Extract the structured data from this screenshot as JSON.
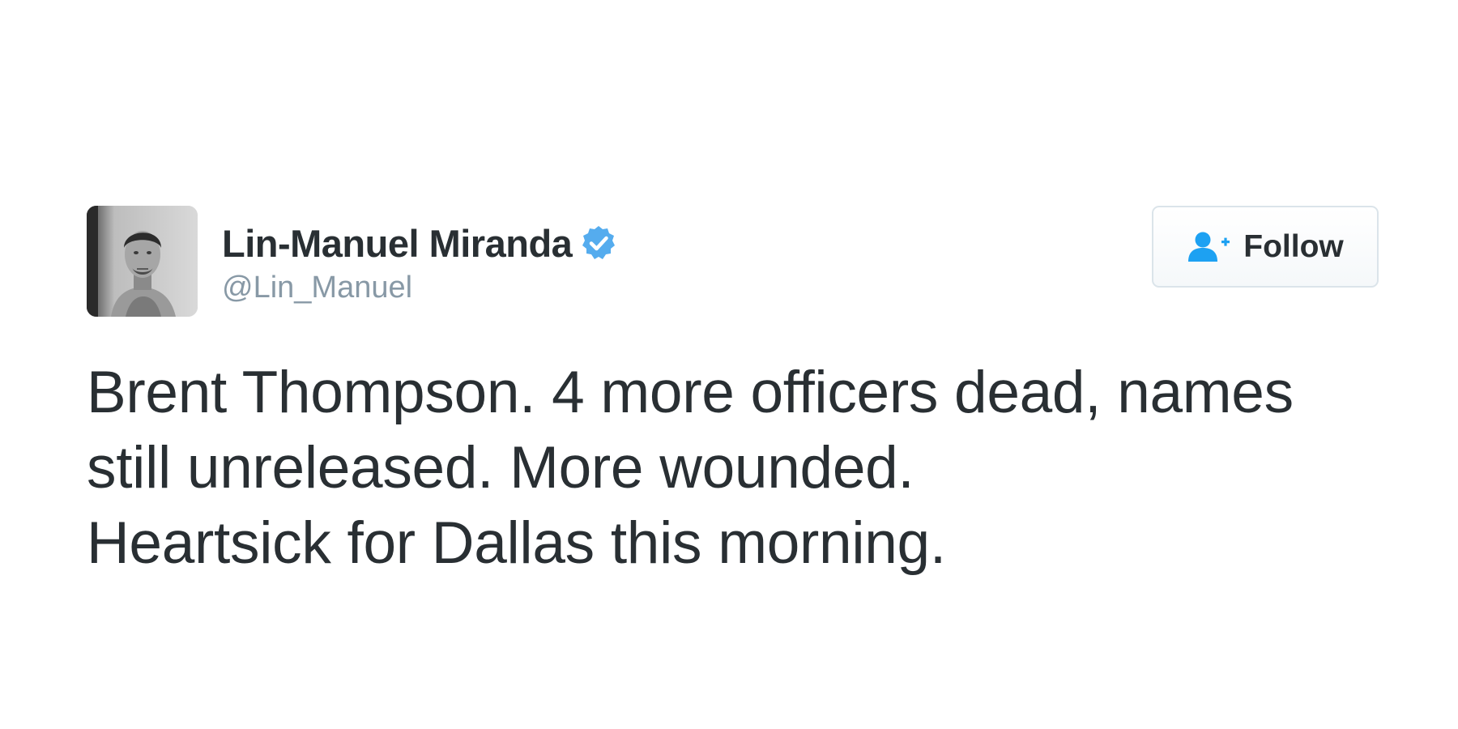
{
  "user": {
    "display_name": "Lin-Manuel Miranda",
    "handle": "@Lin_Manuel",
    "verified": true,
    "avatar_icon": "profile-photo"
  },
  "follow_button": {
    "label": "Follow",
    "icon": "add-user-icon"
  },
  "tweet": {
    "lines": [
      "Brent Thompson. 4 more officers dead, names",
      "still unreleased. More wounded.",
      "Heartsick for Dallas this morning."
    ]
  },
  "colors": {
    "text_primary": "#292f33",
    "text_secondary": "#8899a6",
    "verified_blue": "#55acee",
    "follow_icon_blue": "#1da1f2",
    "button_border": "#dbe4ea"
  }
}
